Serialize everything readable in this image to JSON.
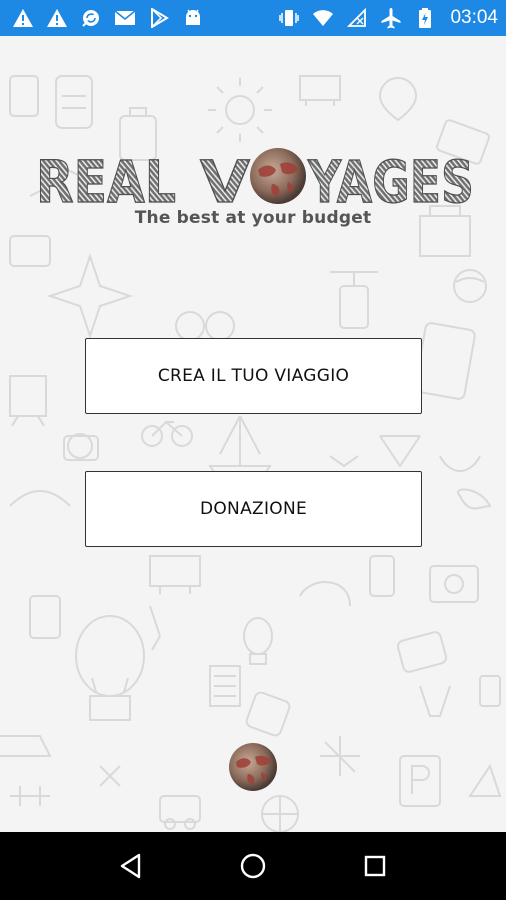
{
  "status_bar": {
    "time": "03:04",
    "left_icons": [
      "warning-icon",
      "warning-icon",
      "sync-icon",
      "mail-icon",
      "play-store-icon",
      "android-icon"
    ],
    "right_icons": [
      "vibrate-icon",
      "wifi-icon",
      "no-signal-icon",
      "airplane-icon",
      "battery-icon"
    ],
    "color": "#1e88e5"
  },
  "app": {
    "logo_text": "REAL VOYAGES",
    "tagline": "The best at your budget",
    "buttons": {
      "create_trip": "CREA IL TUO VIAGGIO",
      "donation": "DONAZIONE"
    }
  },
  "nav_bar": {
    "icons": [
      "back-icon",
      "home-icon",
      "recents-icon"
    ]
  }
}
